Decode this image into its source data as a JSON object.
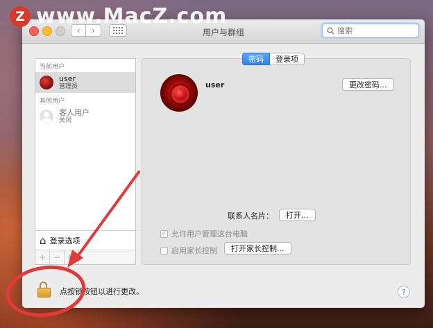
{
  "watermark": {
    "logo": "Z",
    "text": "www.MacZ.com"
  },
  "window": {
    "title": "用户与群组",
    "search": {
      "placeholder": "搜索"
    }
  },
  "sidebar": {
    "current_header": "当前用户",
    "current_user": {
      "name": "user",
      "role": "管理员"
    },
    "other_header": "其他用户",
    "guest_user": {
      "name": "客人用户",
      "role": "关闭"
    },
    "login_options": "登录选项",
    "tools": {
      "add": "+",
      "remove": "−",
      "gear": "⚙"
    }
  },
  "panel": {
    "tabs": [
      {
        "label": "密码",
        "active": true
      },
      {
        "label": "登录项",
        "active": false
      }
    ],
    "username": "user",
    "change_password_label": "更改密码...",
    "contact_card_label": "联系人名片：",
    "open_label": "打开...",
    "allow_admin_label": "允许用户管理这台电脑",
    "allow_admin_checked": true,
    "parental_label": "启用家长控制",
    "parental_checked": false,
    "open_parental_label": "打开家长控制..."
  },
  "footer": {
    "lock_text": "点按锁按钮以进行更改。",
    "help": "?"
  },
  "colors": {
    "accent": "#2f80ea",
    "annotation": "#e23a3a"
  }
}
